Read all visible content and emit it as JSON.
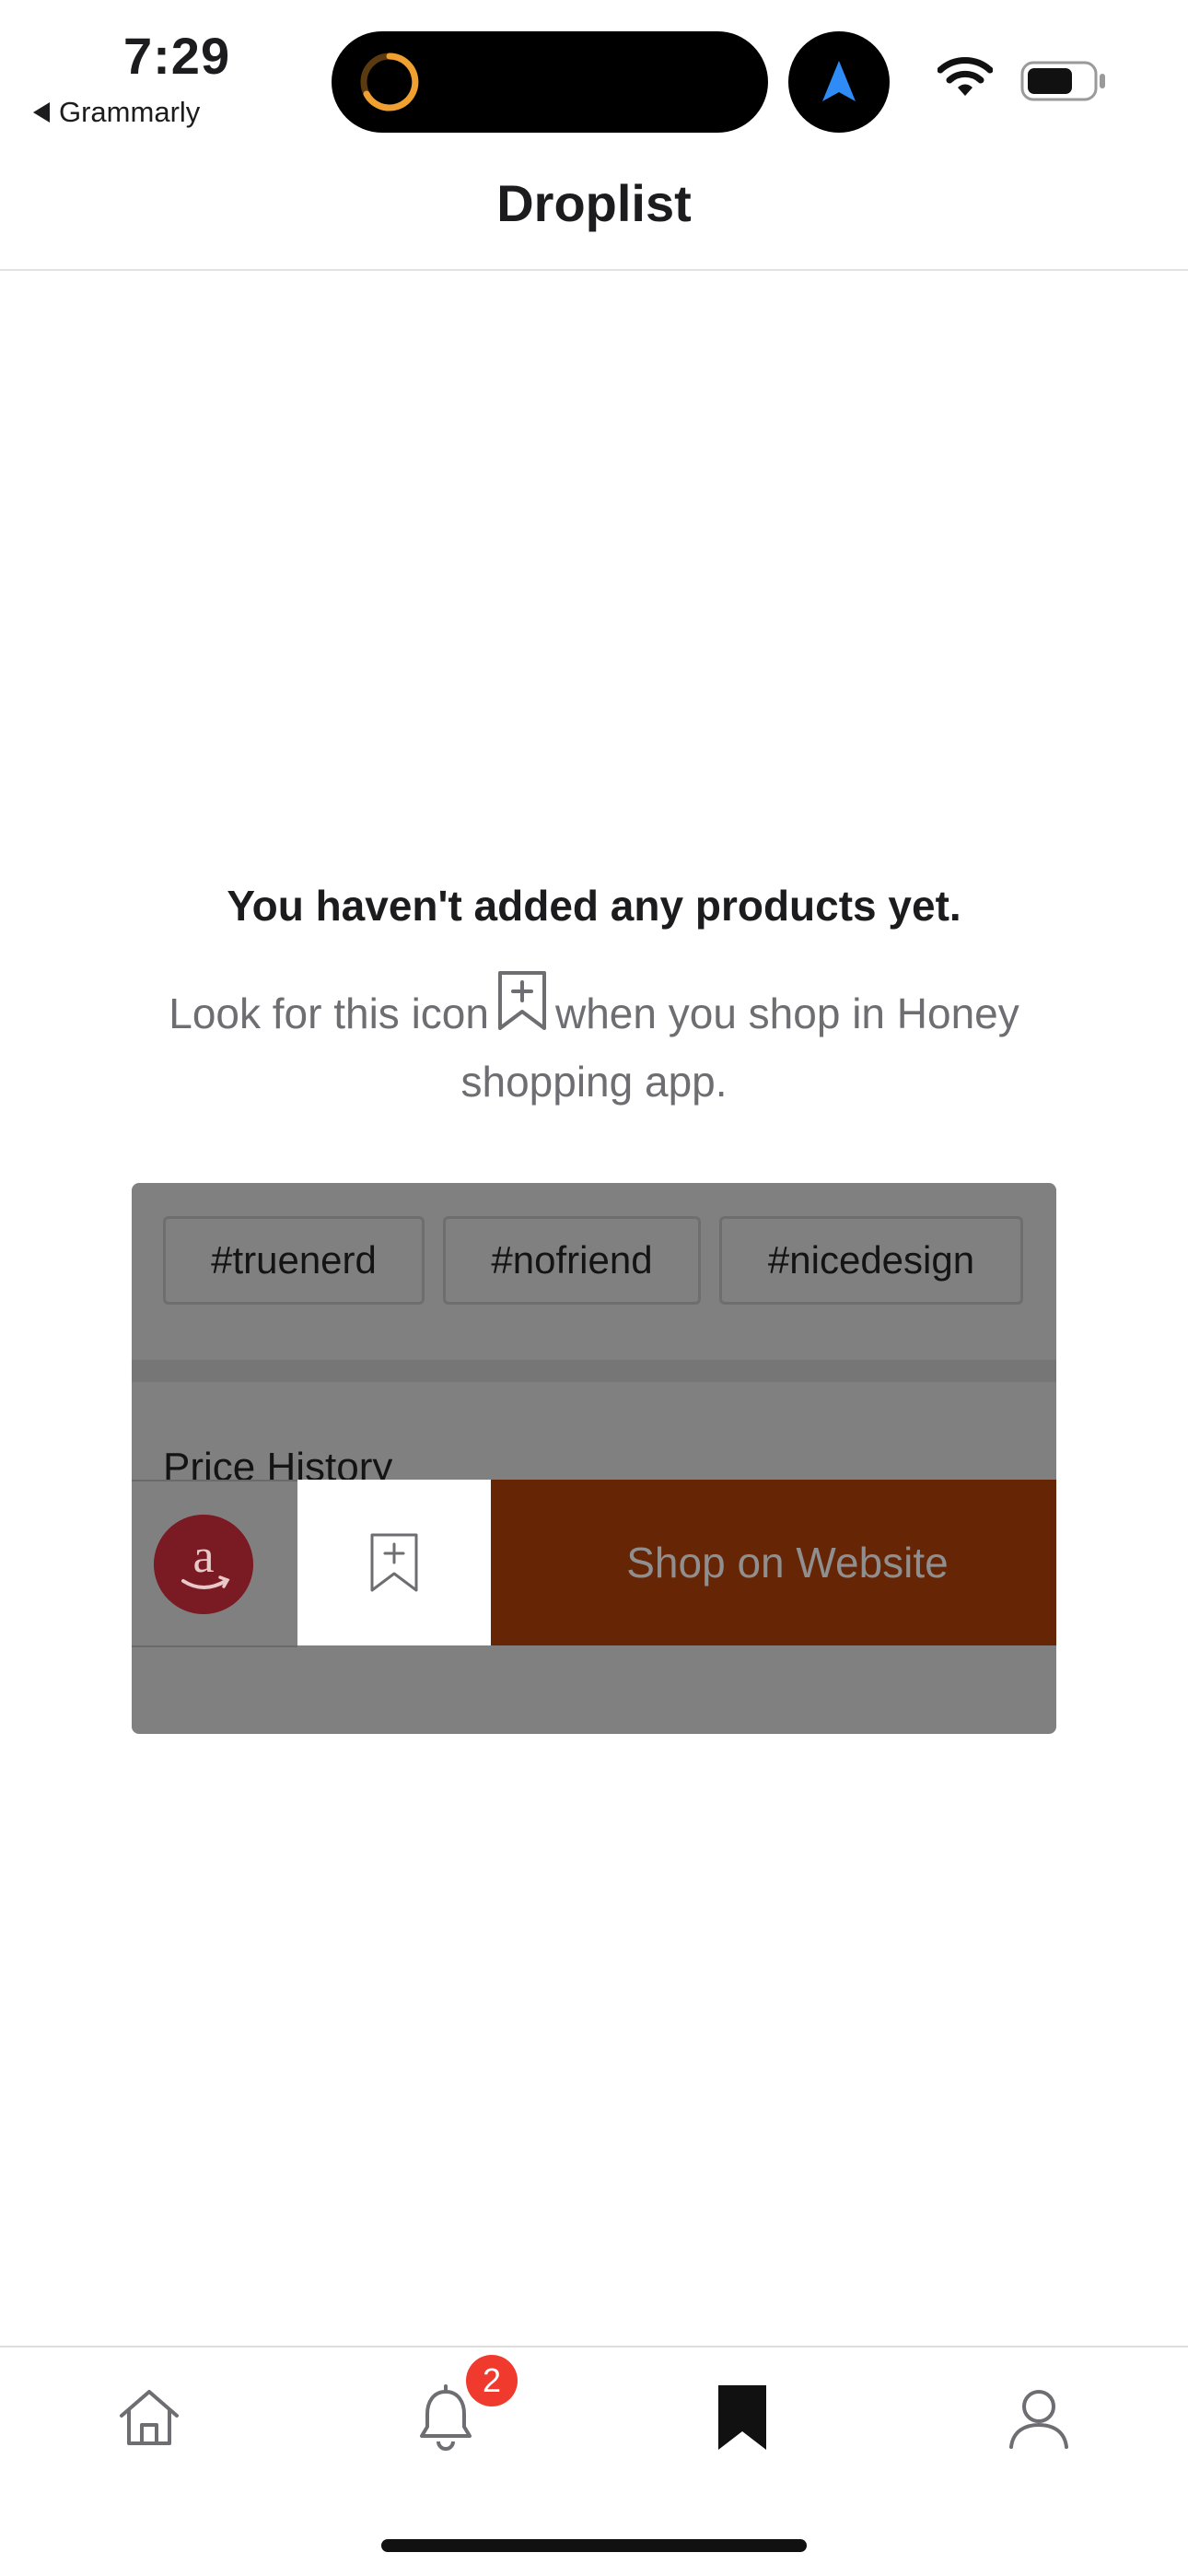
{
  "status_bar": {
    "time": "7:29",
    "back_app": "Grammarly",
    "icons": [
      "activity-ring-icon",
      "navigation-arrow-icon",
      "wifi-icon",
      "battery-icon"
    ],
    "ring_color": "#f0a030",
    "nav_arrow_color": "#2f8cf6"
  },
  "header": {
    "title": "Droplist"
  },
  "empty_state": {
    "title": "You haven't added any products yet.",
    "hint_before": "Look for this icon",
    "hint_after": "when you shop in Honey shopping app."
  },
  "demo": {
    "tags": [
      "#truenerd",
      "#nofriend",
      "#nicedesign"
    ],
    "section_label": "Price History",
    "store_icon": "amazon-logo-icon",
    "save_icon": "bookmark-add-icon",
    "shop_button": "Shop on Website",
    "shop_button_color": "#662505"
  },
  "tab_bar": {
    "tabs": [
      {
        "name": "home",
        "icon": "home-icon"
      },
      {
        "name": "alerts",
        "icon": "bell-icon"
      },
      {
        "name": "droplist",
        "icon": "bookmark-icon",
        "active": true
      },
      {
        "name": "profile",
        "icon": "person-icon"
      }
    ],
    "alerts_badge": "2",
    "badge_color": "#f03a2e"
  }
}
